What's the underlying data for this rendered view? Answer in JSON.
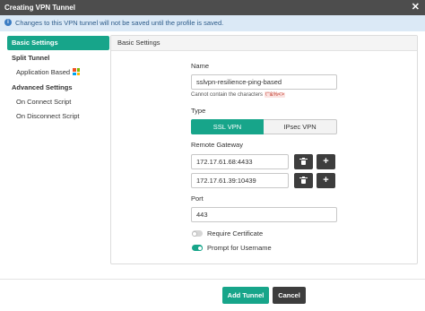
{
  "window": {
    "title": "Creating VPN Tunnel",
    "close_glyph": "✕"
  },
  "info": {
    "icon": "info-icon",
    "text": "Changes to this VPN tunnel will not be saved until the profile is saved."
  },
  "sidebar": {
    "items": [
      {
        "label": "Basic Settings",
        "active": true
      },
      {
        "label": "Split Tunnel"
      },
      {
        "label": "Application Based",
        "icon": "windows-logo-icon"
      },
      {
        "label": "Advanced Settings"
      },
      {
        "label": "On Connect Script"
      },
      {
        "label": "On Disconnect Script"
      }
    ]
  },
  "panel": {
    "title": "Basic Settings",
    "name": {
      "label": "Name",
      "value": "sslvpn-resilience-ping-based",
      "hint_prefix": "Cannot contain the characters",
      "hint_chars": "\\\"'&%<>"
    },
    "type": {
      "label": "Type",
      "options": [
        "SSL VPN",
        "IPsec VPN"
      ],
      "selected": "SSL VPN"
    },
    "gateway": {
      "label": "Remote Gateway",
      "entries": [
        "172.17.61.68:4433",
        "172.17.61.39:10439"
      ],
      "add_glyph": "+"
    },
    "port": {
      "label": "Port",
      "value": "443"
    },
    "require_cert": {
      "label": "Require Certificate",
      "enabled": false
    },
    "prompt_user": {
      "label": "Prompt for Username",
      "enabled": true
    }
  },
  "footer": {
    "add_label": "Add Tunnel",
    "cancel_label": "Cancel"
  },
  "colors": {
    "accent": "#17a58a",
    "titlebar": "#4d4d4d",
    "info_bg": "#dbe9f6",
    "dark_button": "#3d3d3d"
  }
}
